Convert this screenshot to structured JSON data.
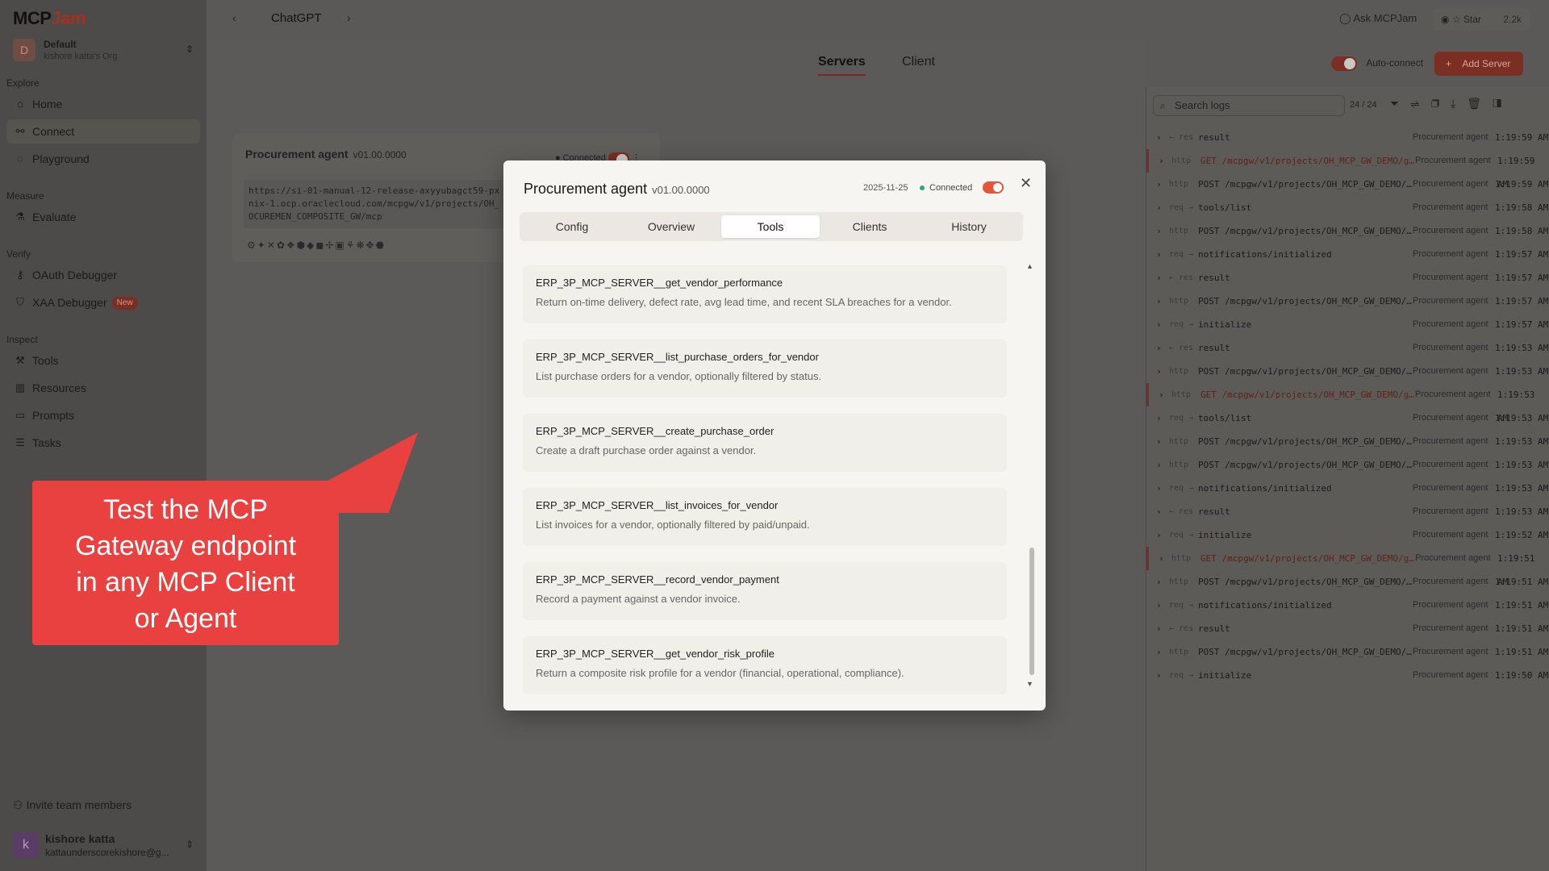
{
  "app": {
    "logo_left": "MCP",
    "logo_right": "Jam",
    "org_initial": "D",
    "org_name": "Default",
    "org_sub": "kishore katta's Org"
  },
  "sidebar": {
    "sections": [
      {
        "title": "Explore",
        "items": [
          {
            "label": "Home",
            "icon": "home-icon"
          },
          {
            "label": "Connect",
            "icon": "plug-icon",
            "active": true
          },
          {
            "label": "Playground",
            "icon": "chat-icon"
          }
        ]
      },
      {
        "title": "Measure",
        "items": [
          {
            "label": "Evaluate",
            "icon": "flask-icon"
          }
        ]
      },
      {
        "title": "Verify",
        "items": [
          {
            "label": "OAuth Debugger",
            "icon": "key-icon"
          },
          {
            "label": "XAA Debugger",
            "icon": "shield-icon",
            "badge": "New"
          }
        ]
      },
      {
        "title": "Inspect",
        "items": [
          {
            "label": "Tools",
            "icon": "hammer-icon"
          },
          {
            "label": "Resources",
            "icon": "book-icon"
          },
          {
            "label": "Prompts",
            "icon": "message-icon"
          },
          {
            "label": "Tasks",
            "icon": "list-icon"
          }
        ]
      }
    ],
    "invite": "Invite team members",
    "user": {
      "initial": "k",
      "name": "kishore katta",
      "email": "kattaunderscorekishore@g..."
    }
  },
  "topbar": {
    "title": "ChatGPT",
    "ask": "Ask MCPJam",
    "star": "Star",
    "star_count": "2.2k"
  },
  "main": {
    "tabs": [
      "Servers",
      "Client"
    ],
    "active_tab": "Servers",
    "auto_connect": "Auto-connect",
    "add_server": "Add Server"
  },
  "server_card": {
    "name": "Procurement agent",
    "version": "v01.00.0000",
    "status": "Connected",
    "url_lines": [
      "https://si-01-manual-12-release-axyyubagct59-px",
      "nix-1.ocp.oraclecloud.com/mcpgw/v1/projects/OH_",
      "OCUREMEN_COMPOSITE_GW/mcp"
    ]
  },
  "logs": {
    "search_placeholder": "Search logs",
    "count": "24 / 24",
    "rows": [
      {
        "type": "← res",
        "text": "result",
        "src": "Procurement agent",
        "time": "1:19:59 AM",
        "err": false
      },
      {
        "type": "http",
        "text": "GET /mcpgw/v1/projects/OH_MCP_GW_DEMO/g…",
        "src": "Procurement agent",
        "time": "1:19:59 AM",
        "err": true
      },
      {
        "type": "http",
        "text": "POST /mcpgw/v1/projects/OH_MCP_GW_DEMO/…",
        "src": "Procurement agent",
        "time": "1:19:59 AM",
        "err": false
      },
      {
        "type": "req →",
        "text": "tools/list",
        "src": "Procurement agent",
        "time": "1:19:58 AM",
        "err": false
      },
      {
        "type": "http",
        "text": "POST /mcpgw/v1/projects/OH_MCP_GW_DEMO/…",
        "src": "Procurement agent",
        "time": "1:19:58 AM",
        "err": false
      },
      {
        "type": "req →",
        "text": "notifications/initialized",
        "src": "Procurement agent",
        "time": "1:19:57 AM",
        "err": false
      },
      {
        "type": "← res",
        "text": "result",
        "src": "Procurement agent",
        "time": "1:19:57 AM",
        "err": false
      },
      {
        "type": "http",
        "text": "POST /mcpgw/v1/projects/OH_MCP_GW_DEMO/…",
        "src": "Procurement agent",
        "time": "1:19:57 AM",
        "err": false
      },
      {
        "type": "req →",
        "text": "initialize",
        "src": "Procurement agent",
        "time": "1:19:57 AM",
        "err": false
      },
      {
        "type": "← res",
        "text": "result",
        "src": "Procurement agent",
        "time": "1:19:53 AM",
        "err": false
      },
      {
        "type": "http",
        "text": "POST /mcpgw/v1/projects/OH_MCP_GW_DEMO/…",
        "src": "Procurement agent",
        "time": "1:19:53 AM",
        "err": false
      },
      {
        "type": "http",
        "text": "GET /mcpgw/v1/projects/OH_MCP_GW_DEMO/g…",
        "src": "Procurement agent",
        "time": "1:19:53 AM",
        "err": true
      },
      {
        "type": "req →",
        "text": "tools/list",
        "src": "Procurement agent",
        "time": "1:19:53 AM",
        "err": false
      },
      {
        "type": "http",
        "text": "POST /mcpgw/v1/projects/OH_MCP_GW_DEMO/…",
        "src": "Procurement agent",
        "time": "1:19:53 AM",
        "err": false
      },
      {
        "type": "http",
        "text": "POST /mcpgw/v1/projects/OH_MCP_GW_DEMO/…",
        "src": "Procurement agent",
        "time": "1:19:53 AM",
        "err": false
      },
      {
        "type": "req →",
        "text": "notifications/initialized",
        "src": "Procurement agent",
        "time": "1:19:53 AM",
        "err": false
      },
      {
        "type": "← res",
        "text": "result",
        "src": "Procurement agent",
        "time": "1:19:53 AM",
        "err": false
      },
      {
        "type": "req →",
        "text": "initialize",
        "src": "Procurement agent",
        "time": "1:19:52 AM",
        "err": false
      },
      {
        "type": "http",
        "text": "GET /mcpgw/v1/projects/OH_MCP_GW_DEMO/g…",
        "src": "Procurement agent",
        "time": "1:19:51 AM",
        "err": true
      },
      {
        "type": "http",
        "text": "POST /mcpgw/v1/projects/OH_MCP_GW_DEMO/…",
        "src": "Procurement agent",
        "time": "1:19:51 AM",
        "err": false
      },
      {
        "type": "req →",
        "text": "notifications/initialized",
        "src": "Procurement agent",
        "time": "1:19:51 AM",
        "err": false
      },
      {
        "type": "← res",
        "text": "result",
        "src": "Procurement agent",
        "time": "1:19:51 AM",
        "err": false
      },
      {
        "type": "http",
        "text": "POST /mcpgw/v1/projects/OH_MCP_GW_DEMO/…",
        "src": "Procurement agent",
        "time": "1:19:51 AM",
        "err": false
      },
      {
        "type": "req →",
        "text": "initialize",
        "src": "Procurement agent",
        "time": "1:19:50 AM",
        "err": false
      }
    ]
  },
  "modal": {
    "title": "Procurement agent",
    "version": "v01.00.0000",
    "date": "2025-11-25",
    "status": "Connected",
    "tabs": [
      "Config",
      "Overview",
      "Tools",
      "Clients",
      "History"
    ],
    "active_tab": "Tools",
    "tools": [
      {
        "name": "ERP_3P_MCP_SERVER__get_vendor_performance",
        "desc": "Return on-time delivery, defect rate, avg lead time, and recent SLA breaches for a vendor."
      },
      {
        "name": "ERP_3P_MCP_SERVER__list_purchase_orders_for_vendor",
        "desc": "List purchase orders for a vendor, optionally filtered by status."
      },
      {
        "name": "ERP_3P_MCP_SERVER__create_purchase_order",
        "desc": "Create a draft purchase order against a vendor."
      },
      {
        "name": "ERP_3P_MCP_SERVER__list_invoices_for_vendor",
        "desc": "List invoices for a vendor, optionally filtered by paid/unpaid."
      },
      {
        "name": "ERP_3P_MCP_SERVER__record_vendor_payment",
        "desc": "Record a payment against a vendor invoice."
      },
      {
        "name": "ERP_3P_MCP_SERVER__get_vendor_risk_profile",
        "desc": "Return a composite risk profile for a vendor (financial, operational, compliance)."
      }
    ]
  },
  "callout": {
    "lines": [
      "Test the MCP",
      "Gateway endpoint",
      "in any MCP Client",
      "or Agent"
    ],
    "color": "#e9413f"
  }
}
